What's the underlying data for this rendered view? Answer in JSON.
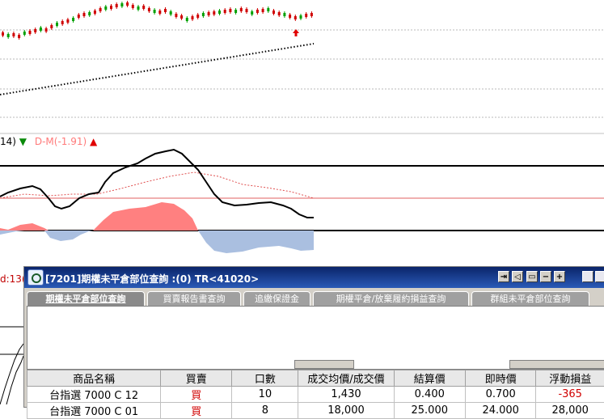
{
  "indicator": {
    "period_tail": "14)",
    "dm_label": "D-M(-1.91)",
    "down_marker": "▼",
    "up_marker": "▲"
  },
  "side_label": "d:13(",
  "colors": {
    "candle_up": "#d00000",
    "candle_down": "#00a000",
    "positive_fill": "#ff8080",
    "negative_fill": "#aabfe0",
    "titlebar": "#0a246a"
  },
  "window": {
    "title": "[7201]期權未平倉部位查詢 :(0) TR<41020>",
    "control_icons": [
      "export-icon",
      "back-icon",
      "restore-icon",
      "minimize-icon",
      "maximize-icon"
    ],
    "control_glyphs": [
      "⇥",
      "◁",
      "▭",
      "−",
      "+"
    ],
    "tabs": [
      {
        "label": "期權未平倉部位查詢",
        "active": true
      },
      {
        "label": "買賣報告書查詢",
        "active": false
      },
      {
        "label": "追繳保證金",
        "active": false
      },
      {
        "label": "期權平倉/放棄履約損益查詢",
        "active": false
      },
      {
        "label": "群組未平倉部位查詢",
        "active": false
      }
    ],
    "table": {
      "headers": [
        "商品名稱",
        "買賣",
        "口數",
        "成交均價/成交價",
        "結算價",
        "即時價",
        "浮動損益"
      ],
      "rows": [
        [
          "台指選    7000 C 12",
          "買",
          "10",
          "1,430",
          "0.400",
          "0.700",
          "-365"
        ],
        [
          "台指選    7000 C 01",
          "買",
          "8",
          "18,000",
          "25.000",
          "24.000",
          "28,000"
        ]
      ]
    }
  }
}
